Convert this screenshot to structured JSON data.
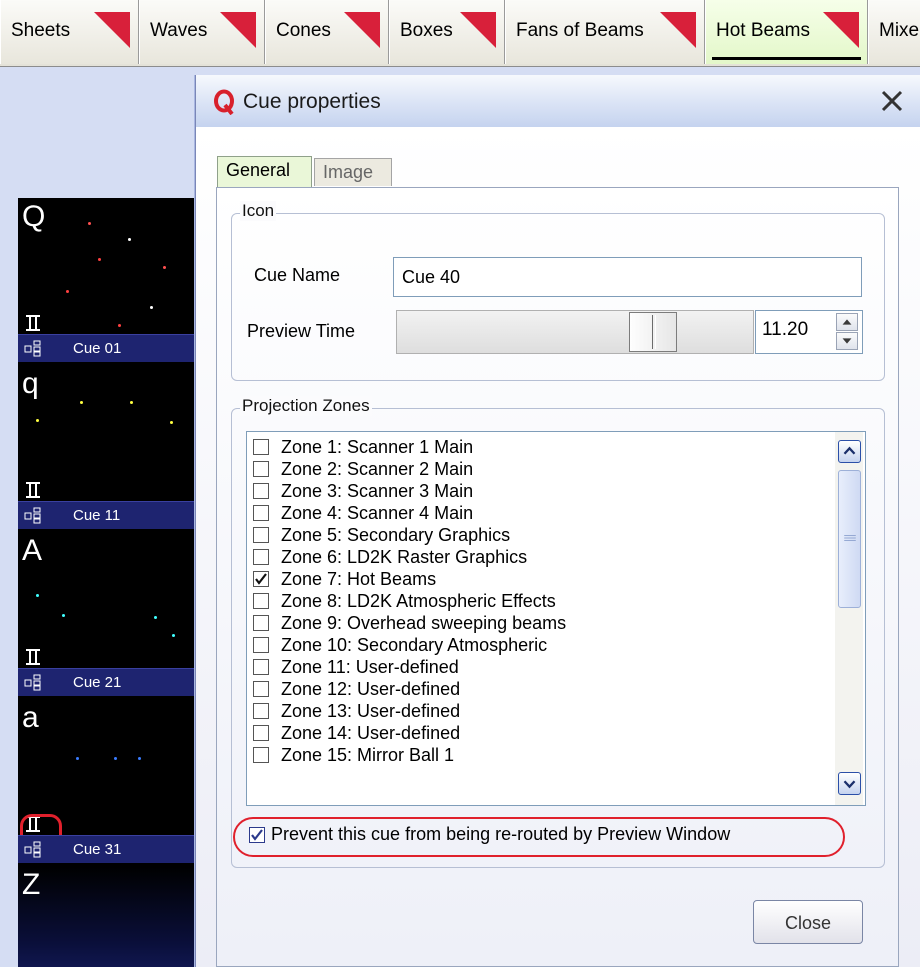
{
  "tabs": [
    {
      "label": "Sheets"
    },
    {
      "label": "Waves"
    },
    {
      "label": "Cones"
    },
    {
      "label": "Boxes"
    },
    {
      "label": "Fans of Beams"
    },
    {
      "label": "Hot Beams",
      "active": true
    },
    {
      "label": "Mixe"
    }
  ],
  "cues": [
    {
      "letter": "Q",
      "name": "Cue 01",
      "dot_color": "#ff4040"
    },
    {
      "letter": "q",
      "name": "Cue 11",
      "dot_color": "#ffff40"
    },
    {
      "letter": "A",
      "name": "Cue 21",
      "dot_color": "#40ffff"
    },
    {
      "letter": "a",
      "name": "Cue 31",
      "dot_color": "#4080ff"
    },
    {
      "letter": "Z"
    }
  ],
  "dialog": {
    "title": "Cue properties",
    "tabs": {
      "general": "General",
      "image": "Image"
    },
    "icon_group": {
      "label": "Icon",
      "cue_name_label": "Cue Name",
      "cue_name_value": "Cue 40",
      "preview_time_label": "Preview Time",
      "preview_time_value": "11.20"
    },
    "zones_group": {
      "label": "Projection Zones",
      "zones": [
        {
          "label": "Zone 1: Scanner 1 Main",
          "checked": false
        },
        {
          "label": "Zone 2: Scanner 2 Main",
          "checked": false
        },
        {
          "label": "Zone 3: Scanner 3 Main",
          "checked": false
        },
        {
          "label": "Zone 4: Scanner 4 Main",
          "checked": false
        },
        {
          "label": "Zone 5: Secondary Graphics",
          "checked": false
        },
        {
          "label": "Zone 6: LD2K Raster Graphics",
          "checked": false
        },
        {
          "label": "Zone 7: Hot Beams",
          "checked": true
        },
        {
          "label": "Zone 8: LD2K Atmospheric Effects",
          "checked": false
        },
        {
          "label": "Zone 9: Overhead sweeping beams",
          "checked": false
        },
        {
          "label": "Zone 10: Secondary Atmospheric",
          "checked": false
        },
        {
          "label": "Zone 11: User-defined",
          "checked": false
        },
        {
          "label": "Zone 12: User-defined",
          "checked": false
        },
        {
          "label": "Zone 13: User-defined",
          "checked": false
        },
        {
          "label": "Zone 14: User-defined",
          "checked": false
        },
        {
          "label": "Zone 15: Mirror Ball 1",
          "checked": false
        }
      ]
    },
    "prevent_reroute": {
      "label": "Prevent this cue from being re-routed by Preview Window",
      "checked": true
    },
    "close_label": "Close"
  },
  "colors": {
    "highlight": "#e0202c",
    "tab_marker": "#d8203a",
    "cue_footer": "#1e2470"
  }
}
